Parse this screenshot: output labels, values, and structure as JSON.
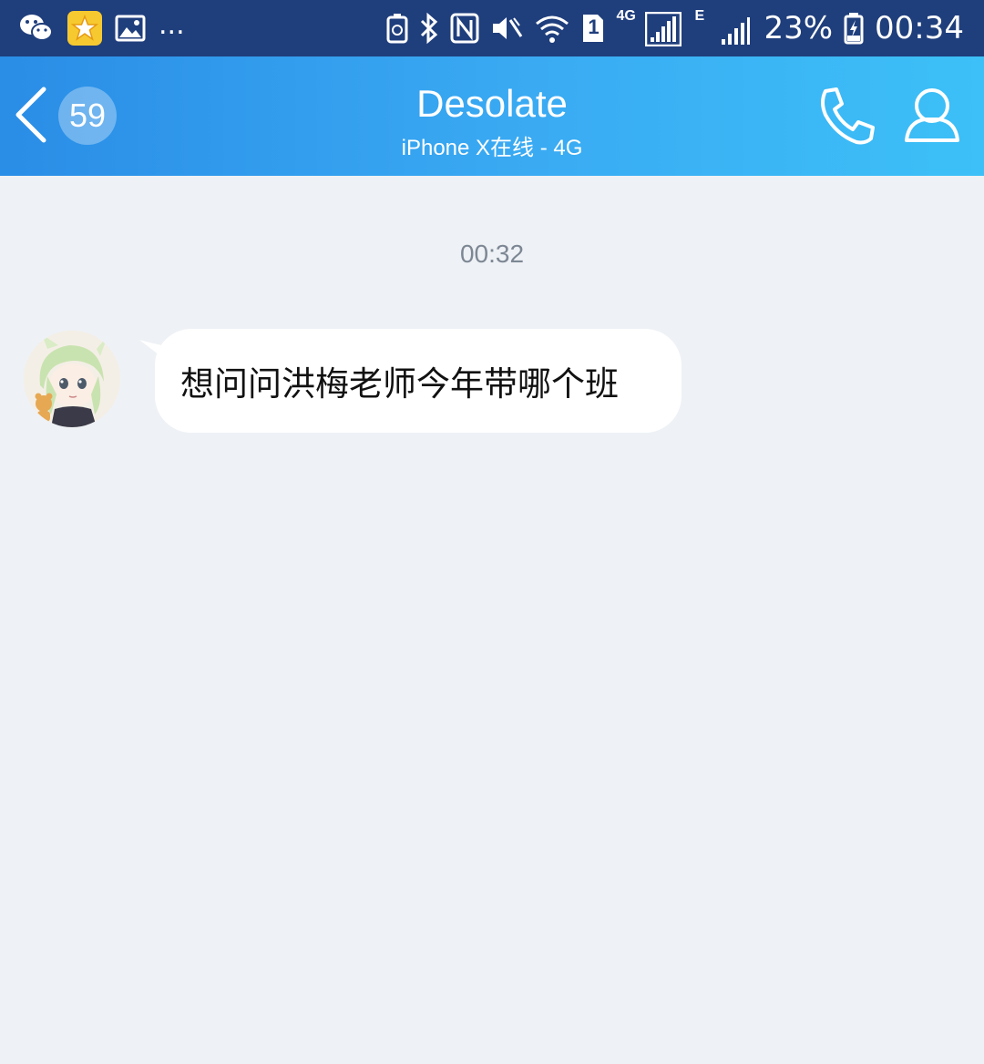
{
  "status_bar": {
    "left_icons": [
      "wechat-icon",
      "qzone-app-icon",
      "gallery-icon"
    ],
    "more": "...",
    "right_icons": [
      "battery-saver-icon",
      "bluetooth-icon",
      "nfc-icon",
      "mute-icon",
      "wifi-icon",
      "sim-icon",
      "4g-signal-icon",
      "e-signal-icon"
    ],
    "sim_slot": "1",
    "network_4g": "4G",
    "network_e": "E",
    "battery": "23%",
    "time": "00:34"
  },
  "header": {
    "back_icon": "chevron-left-icon",
    "unread_count": "59",
    "contact_name": "Desolate",
    "contact_status": "iPhone X在线 - 4G",
    "call_icon": "phone-icon",
    "profile_icon": "person-icon",
    "colors": {
      "gradient_start": "#2a8de6",
      "gradient_end": "#3cc0f7"
    }
  },
  "chat": {
    "timestamp": "00:32",
    "messages": [
      {
        "direction": "incoming",
        "avatar_icon": "anime-girl-avatar",
        "text": "想问问洪梅老师今年带哪个班"
      }
    ],
    "background": "#eef1f5"
  }
}
